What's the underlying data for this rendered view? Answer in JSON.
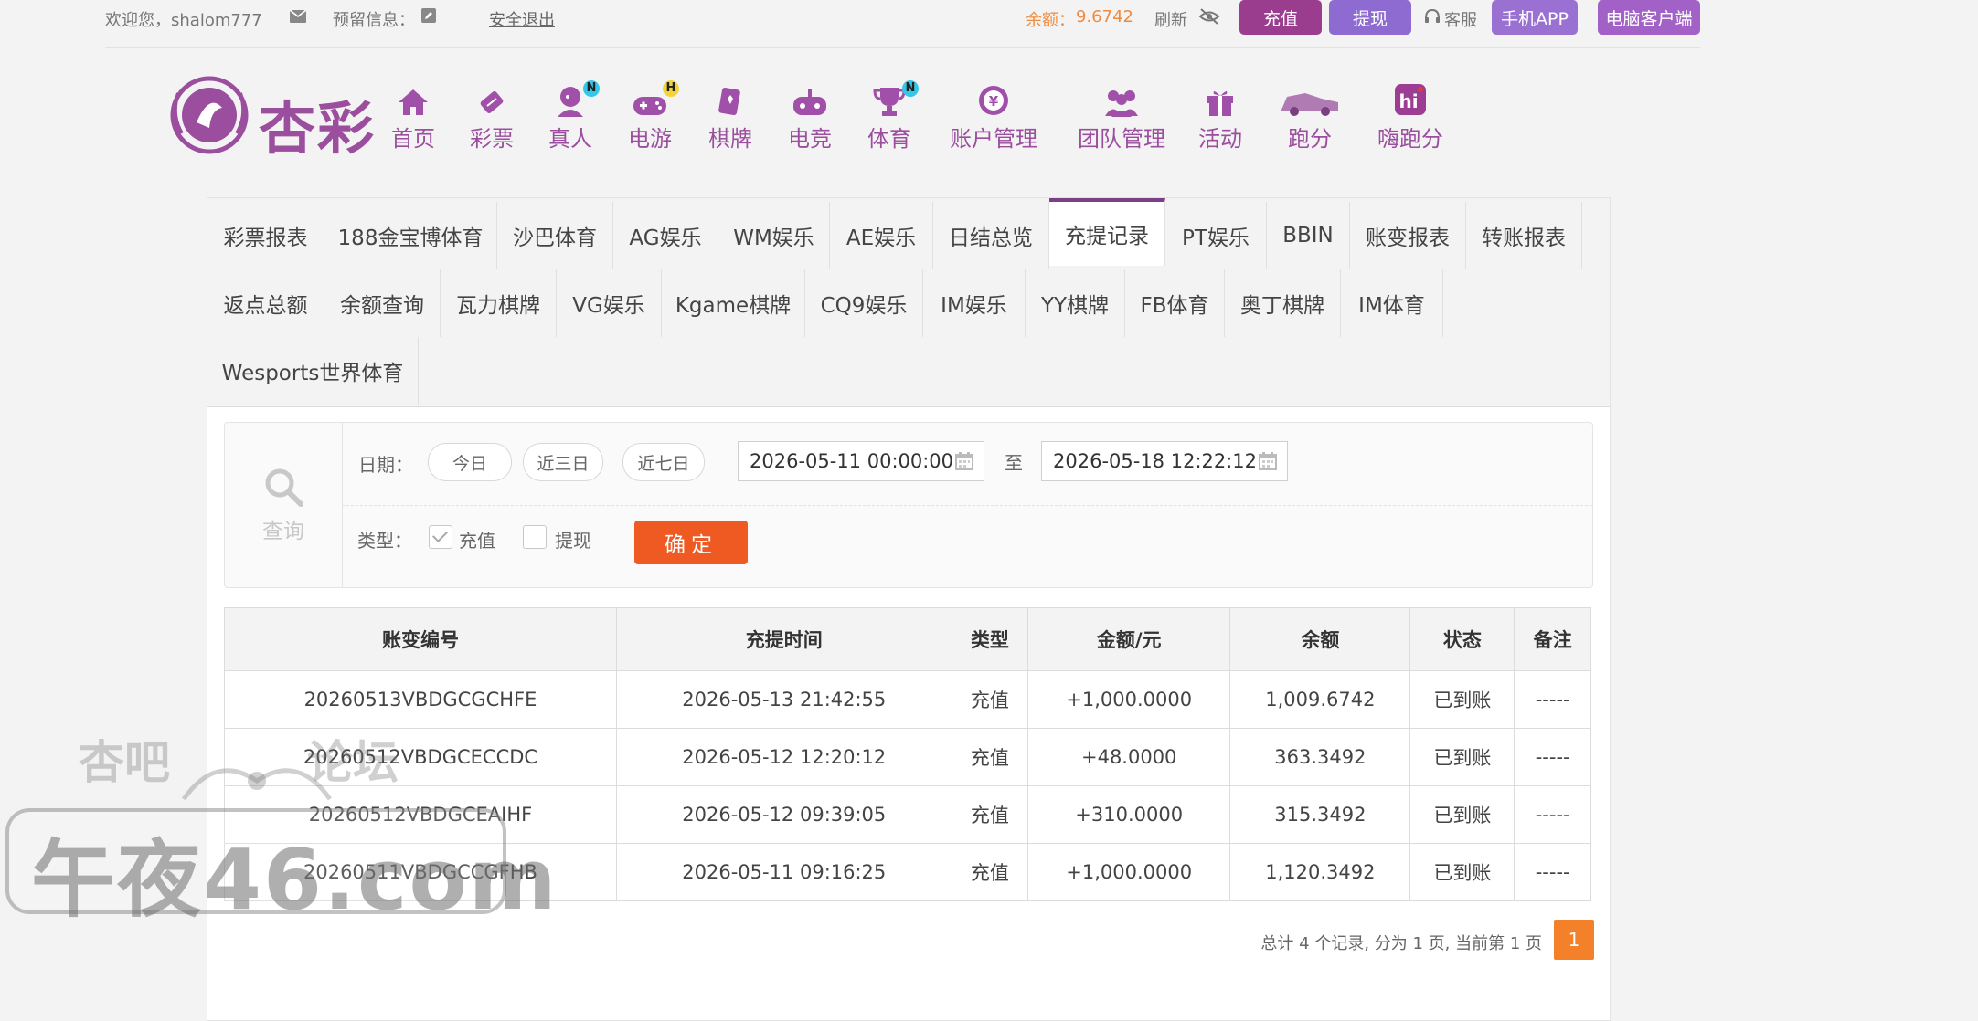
{
  "topbar": {
    "welcome": "欢迎您，shalom777",
    "reserve_label": "预留信息：",
    "logout": "安全退出",
    "balance_label": "余额：",
    "balance_value": "9.6742",
    "refresh": "刷新",
    "recharge": "充值",
    "withdraw": "提现",
    "service": "客服",
    "mobile_app": "手机APP",
    "pc_client": "电脑客户端"
  },
  "logo_text": "杏彩",
  "nav": [
    {
      "label": "首页",
      "icon": "home-icon",
      "badge": ""
    },
    {
      "label": "彩票",
      "icon": "ticket-icon",
      "badge": ""
    },
    {
      "label": "真人",
      "icon": "dealer-icon",
      "badge": "N"
    },
    {
      "label": "电游",
      "icon": "gamepad-icon",
      "badge": "H"
    },
    {
      "label": "棋牌",
      "icon": "card-icon",
      "badge": ""
    },
    {
      "label": "电竞",
      "icon": "joystick-icon",
      "badge": ""
    },
    {
      "label": "体育",
      "icon": "trophy-icon",
      "badge": "N"
    },
    {
      "label": "账户管理",
      "icon": "yen-coin-icon",
      "badge": ""
    },
    {
      "label": "团队管理",
      "icon": "team-icon",
      "badge": ""
    },
    {
      "label": "活动",
      "icon": "gift-icon",
      "badge": ""
    },
    {
      "label": "跑分",
      "icon": "car-icon",
      "badge": ""
    },
    {
      "label": "嗨跑分",
      "icon": "hi-icon",
      "badge": ""
    }
  ],
  "tabs": [
    [
      "彩票报表",
      "188金宝博体育",
      "沙巴体育",
      "AG娱乐",
      "WM娱乐",
      "AE娱乐",
      "日结总览",
      "充提记录",
      "PT娱乐",
      "BBIN",
      "账变报表",
      "转账报表"
    ],
    [
      "返点总额",
      "余额查询",
      "瓦力棋牌",
      "VG娱乐",
      "Kgame棋牌",
      "CQ9娱乐",
      "IM娱乐",
      "YY棋牌",
      "FB体育",
      "奥丁棋牌",
      "IM体育"
    ],
    [
      "Wesports世界体育"
    ]
  ],
  "active_tab": "充提记录",
  "query": {
    "side_label": "查询",
    "date_label": "日期：",
    "chips": [
      "今日",
      "近三日",
      "近七日"
    ],
    "date_from": "2026-05-11 00:00:00",
    "to_label": "至",
    "date_to": "2026-05-18 12:22:12",
    "type_label": "类型：",
    "type_recharge": "充值",
    "type_recharge_checked": true,
    "type_withdraw": "提现",
    "type_withdraw_checked": false,
    "confirm": "确定"
  },
  "table": {
    "headers": [
      "账变编号",
      "充提时间",
      "类型",
      "金额/元",
      "余额",
      "状态",
      "备注"
    ],
    "rows": [
      [
        "20260513VBDGCGCHFE",
        "2026-05-13 21:42:55",
        "充值",
        "+1,000.0000",
        "1,009.6742",
        "已到账",
        "-----"
      ],
      [
        "20260512VBDGCECCDC",
        "2026-05-12 12:20:12",
        "充值",
        "+48.0000",
        "363.3492",
        "已到账",
        "-----"
      ],
      [
        "20260512VBDGCEAIHF",
        "2026-05-12 09:39:05",
        "充值",
        "+310.0000",
        "315.3492",
        "已到账",
        "-----"
      ],
      [
        "20260511VBDGCCGFHB",
        "2026-05-11 09:16:25",
        "充值",
        "+1,000.0000",
        "1,120.3492",
        "已到账",
        "-----"
      ]
    ]
  },
  "pager": {
    "summary": "总计 4 个记录, 分为 1 页, 当前第 1 页",
    "current": "1"
  },
  "watermark": {
    "line1a": "杏吧",
    "line1b": "论坛",
    "main": "午夜46.com"
  },
  "colors": {
    "brand": "#9b4d9e",
    "amount": "#d81e06",
    "status_ok": "#2e9b3a",
    "confirm": "#ee5a22",
    "pager": "#f4802a"
  }
}
